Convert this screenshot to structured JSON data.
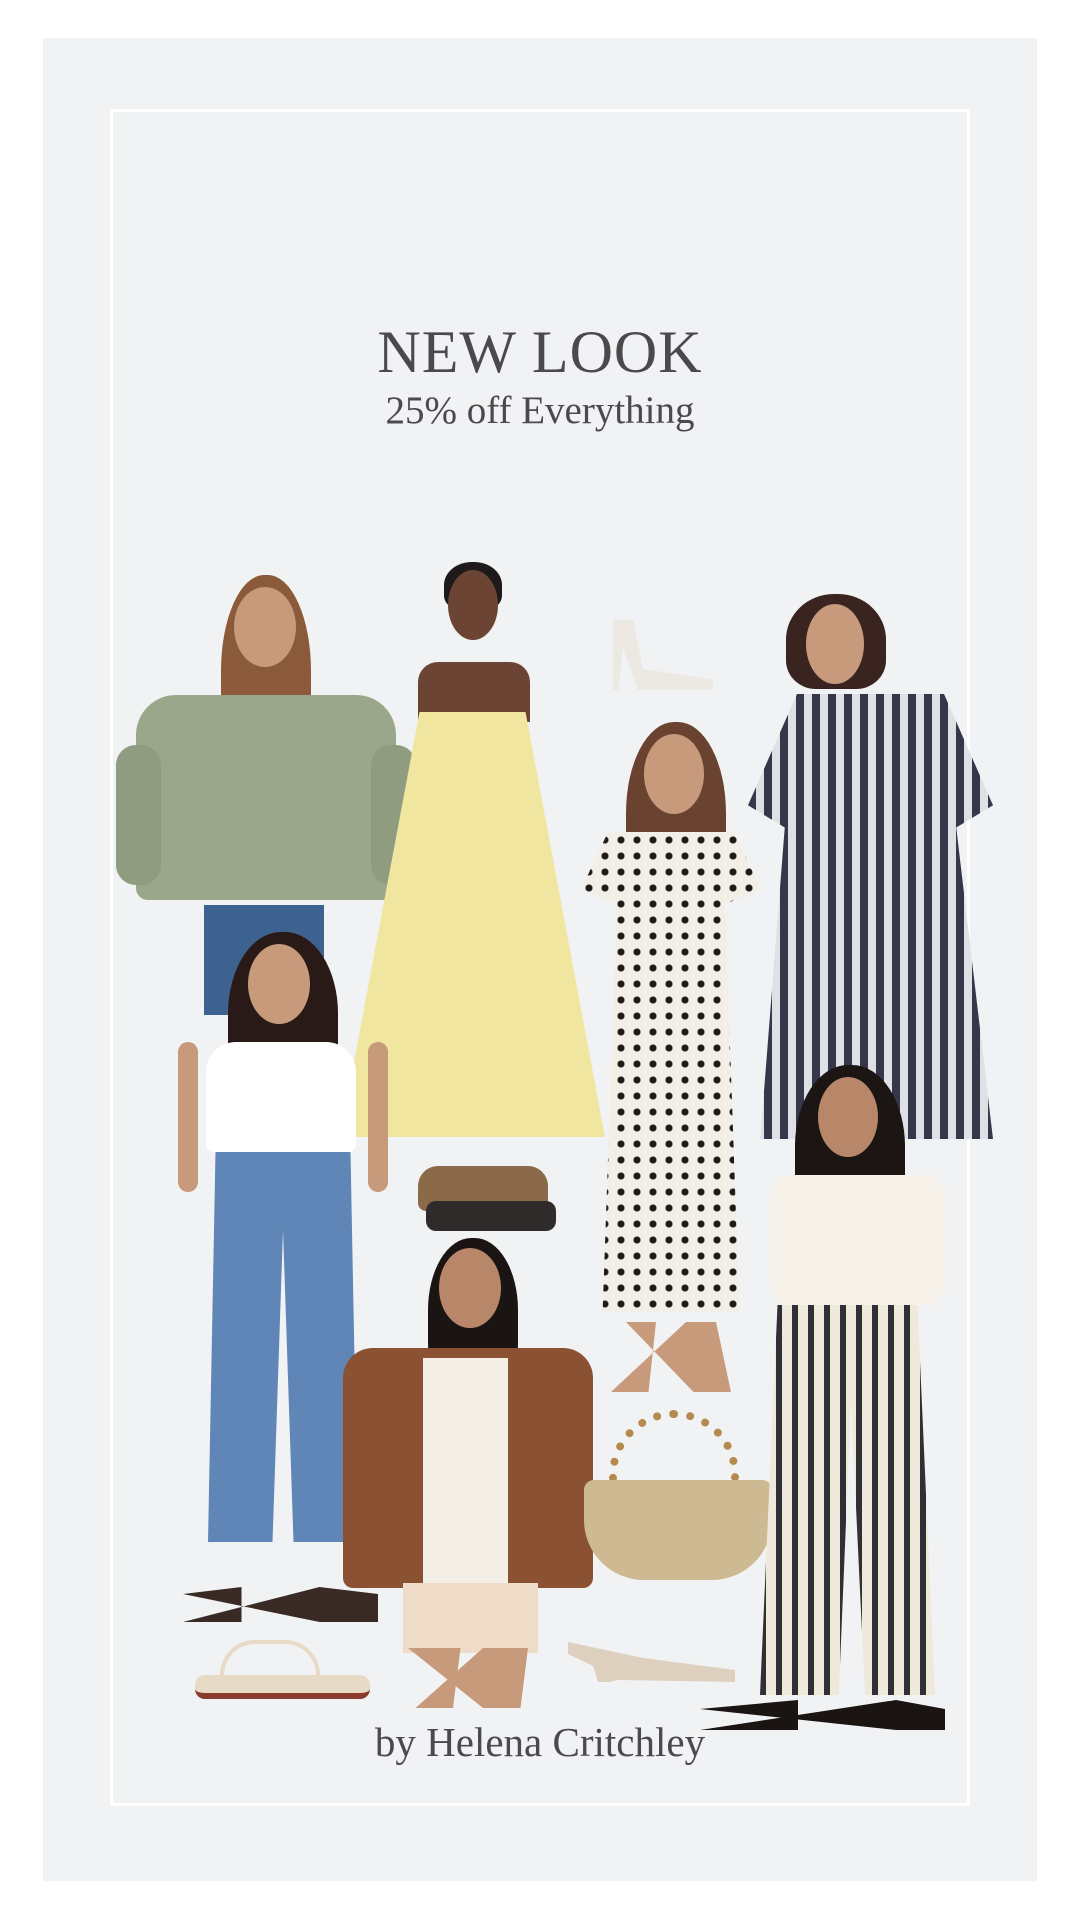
{
  "header": {
    "title": "NEW LOOK",
    "subtitle": "25% off Everything"
  },
  "footer": {
    "credit": "by Helena Critchley"
  },
  "products": [
    {
      "name": "khaki utility jacket",
      "color": "#9aa78b"
    },
    {
      "name": "yellow broderie maxi dress",
      "color": "#f1e6a0"
    },
    {
      "name": "white strappy heels",
      "color": "#ece8e2"
    },
    {
      "name": "gingham puff sleeve midi dress",
      "color": "#34384a"
    },
    {
      "name": "polka dot midi dress",
      "color": "#f3efe6"
    },
    {
      "name": "white tee and wide leg jeans",
      "color": "#5f86b6"
    },
    {
      "name": "tan buckle sandals",
      "color": "#8b6a4a"
    },
    {
      "name": "suede jacket and lace shorts",
      "color": "#8a5232"
    },
    {
      "name": "beaded straw bag",
      "color": "#cdb992"
    },
    {
      "name": "off shoulder tee and striped trousers",
      "color": "#2f2f35"
    },
    {
      "name": "flat toe post sandals",
      "color": "#e7dac6"
    },
    {
      "name": "kitten heel mules",
      "color": "#ded0bf"
    }
  ]
}
